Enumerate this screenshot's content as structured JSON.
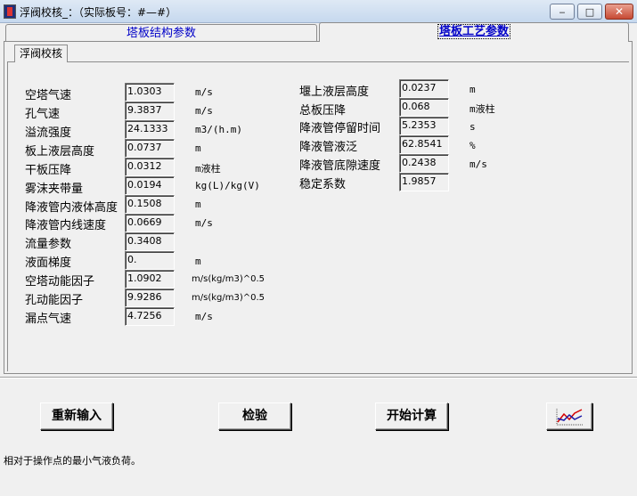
{
  "window": {
    "title": "浮阀校核_：（实际板号：#—#）",
    "minimize": "‒",
    "maximize": "□",
    "close": "✕"
  },
  "tabs": [
    {
      "label": "塔板结构参数",
      "active": false
    },
    {
      "label": "塔板工艺参数",
      "active": true
    }
  ],
  "subtab": {
    "label": "浮阀校核"
  },
  "left_params": [
    {
      "label": "空塔气速",
      "value": "1.0303",
      "unit": "m/s"
    },
    {
      "label": "孔气速",
      "value": "9.3837",
      "unit": "m/s"
    },
    {
      "label": "溢流强度",
      "value": "24.1333",
      "unit": "m3/(h.m)"
    },
    {
      "label": "板上液层高度",
      "value": "0.0737",
      "unit": "m"
    },
    {
      "label": "干板压降",
      "value": "0.0312",
      "unit": "m液柱"
    },
    {
      "label": "雾沫夹带量",
      "value": "0.0194",
      "unit": "kg(L)/kg(V)"
    },
    {
      "label": "降液管内液体高度",
      "value": "0.1508",
      "unit": "m"
    },
    {
      "label": "降液管内线速度",
      "value": "0.0669",
      "unit": "m/s"
    },
    {
      "label": "流量参数",
      "value": "0.3408",
      "unit": ""
    },
    {
      "label": "液面梯度",
      "value": "0.",
      "unit": "m"
    },
    {
      "label": "空塔动能因子",
      "value": "1.0902",
      "unit": "m/s(kg/m3)^0.5"
    },
    {
      "label": "孔动能因子",
      "value": "9.9286",
      "unit": "m/s(kg/m3)^0.5"
    },
    {
      "label": "漏点气速",
      "value": "4.7256",
      "unit": "m/s"
    }
  ],
  "right_params": [
    {
      "label": "堰上液层高度",
      "value": "0.0237",
      "unit": "m"
    },
    {
      "label": "总板压降",
      "value": "0.068",
      "unit": "m液柱"
    },
    {
      "label": "降液管停留时间",
      "value": "5.2353",
      "unit": "s"
    },
    {
      "label": "降液管液泛",
      "value": "62.8541",
      "unit": "%"
    },
    {
      "label": "降液管底隙速度",
      "value": "0.2438",
      "unit": "m/s"
    },
    {
      "label": "稳定系数",
      "value": "1.9857",
      "unit": ""
    }
  ],
  "buttons": {
    "reinput": "重新输入",
    "check": "检验",
    "calculate": "开始计算",
    "chart_icon": "line-chart-icon"
  },
  "status_text": "相对于操作点的最小气液负荷。",
  "colors": {
    "tab_text": "#0000c8",
    "chart_red": "#d40000",
    "chart_blue": "#1a1aa6"
  }
}
